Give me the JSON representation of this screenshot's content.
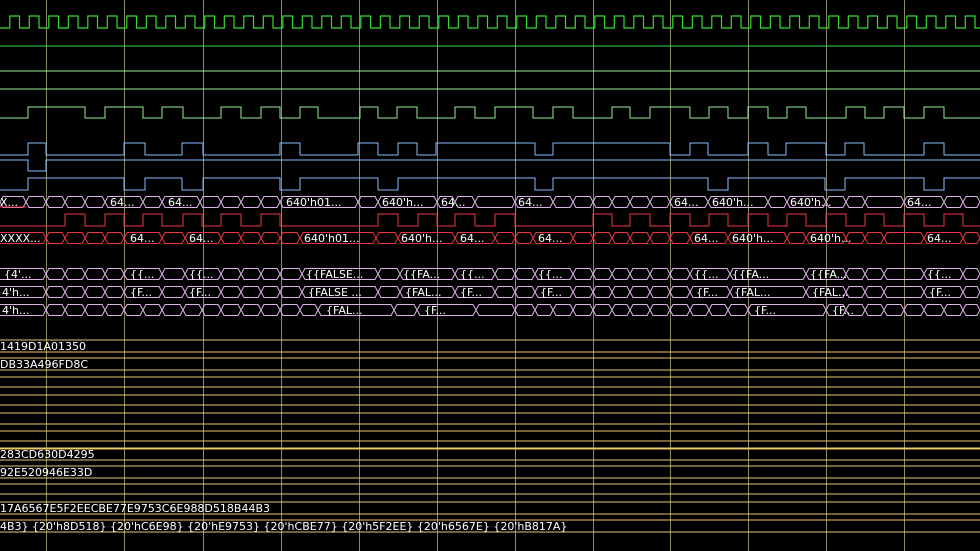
{
  "colors": {
    "background": "#000000",
    "clock": "#33dd33",
    "bit_green": "#99ee99",
    "bit_blue": "#88bbff",
    "bus_red": "#ee3344",
    "bus_pink": "#e0b0e8",
    "bus_yellow": "#e8c86a",
    "text": "#ffffff",
    "cursor": "#ffffaa"
  },
  "signals": {
    "r4": {
      "labels": [
        {
          "key": "a",
          "text": "X..."
        },
        {
          "key": "b",
          "text": "64..."
        },
        {
          "key": "c",
          "text": "64..."
        },
        {
          "key": "d",
          "text": "640'h01..."
        },
        {
          "key": "e",
          "text": "640'h..."
        },
        {
          "key": "f",
          "text": "64..."
        },
        {
          "key": "g",
          "text": "64..."
        },
        {
          "key": "h",
          "text": "64..."
        },
        {
          "key": "i",
          "text": "640'h..."
        },
        {
          "key": "j",
          "text": "640'h..."
        },
        {
          "key": "k",
          "text": "64..."
        }
      ]
    },
    "r6": {
      "labels": [
        {
          "key": "a",
          "text": "XXXX..."
        },
        {
          "key": "b",
          "text": "64..."
        },
        {
          "key": "c",
          "text": "64..."
        },
        {
          "key": "d",
          "text": "640'h01..."
        },
        {
          "key": "e",
          "text": "640'h..."
        },
        {
          "key": "f",
          "text": "64..."
        },
        {
          "key": "g",
          "text": "64..."
        },
        {
          "key": "h",
          "text": "64..."
        },
        {
          "key": "i",
          "text": "640'h..."
        },
        {
          "key": "j",
          "text": "640'h..."
        },
        {
          "key": "k",
          "text": "64..."
        }
      ]
    },
    "r7": {
      "labels": [
        {
          "key": "a",
          "text": "{4'..."
        },
        {
          "key": "b",
          "text": "{{..."
        },
        {
          "key": "c",
          "text": "{{..."
        },
        {
          "key": "d",
          "text": "{{FALSE..."
        },
        {
          "key": "e",
          "text": "{{FA..."
        },
        {
          "key": "f",
          "text": "{{..."
        },
        {
          "key": "g",
          "text": "{{..."
        },
        {
          "key": "h",
          "text": "{{..."
        },
        {
          "key": "i",
          "text": "{{FA..."
        },
        {
          "key": "j",
          "text": "{{FA..."
        },
        {
          "key": "k",
          "text": "{{..."
        }
      ]
    },
    "r8": {
      "labels": [
        {
          "key": "a",
          "text": "4'h..."
        },
        {
          "key": "b",
          "text": "{F..."
        },
        {
          "key": "c",
          "text": "{F..."
        },
        {
          "key": "d",
          "text": "{FALSE ..."
        },
        {
          "key": "e",
          "text": "{FAL..."
        },
        {
          "key": "f",
          "text": "{F..."
        },
        {
          "key": "g",
          "text": "{F..."
        },
        {
          "key": "h",
          "text": "{F..."
        },
        {
          "key": "i",
          "text": "{FAL..."
        },
        {
          "key": "j",
          "text": "{FAL..."
        },
        {
          "key": "k",
          "text": "{F..."
        }
      ]
    },
    "r9": {
      "labels": [
        {
          "key": "a",
          "text": "4'h..."
        },
        {
          "key": "b",
          "text": "{FAL..."
        },
        {
          "key": "c",
          "text": "{F..."
        },
        {
          "key": "d",
          "text": "{F..."
        },
        {
          "key": "e",
          "text": "{F..."
        }
      ]
    },
    "bus_values": {
      "v1": "1419D1A01350",
      "v2": "DB33A496FD8C",
      "v3": "283CD630D4295",
      "v4": "92E520946E33D",
      "v5": "17A6567E5F2EECBE77E9753C6E988D518B44B3",
      "v6": "4B3} {20'h8D518} {20'hC6E98} {20'hE9753} {20'hCBE77} {20'h5F2EE} {20'h6567E} {20'hB817A}"
    }
  }
}
